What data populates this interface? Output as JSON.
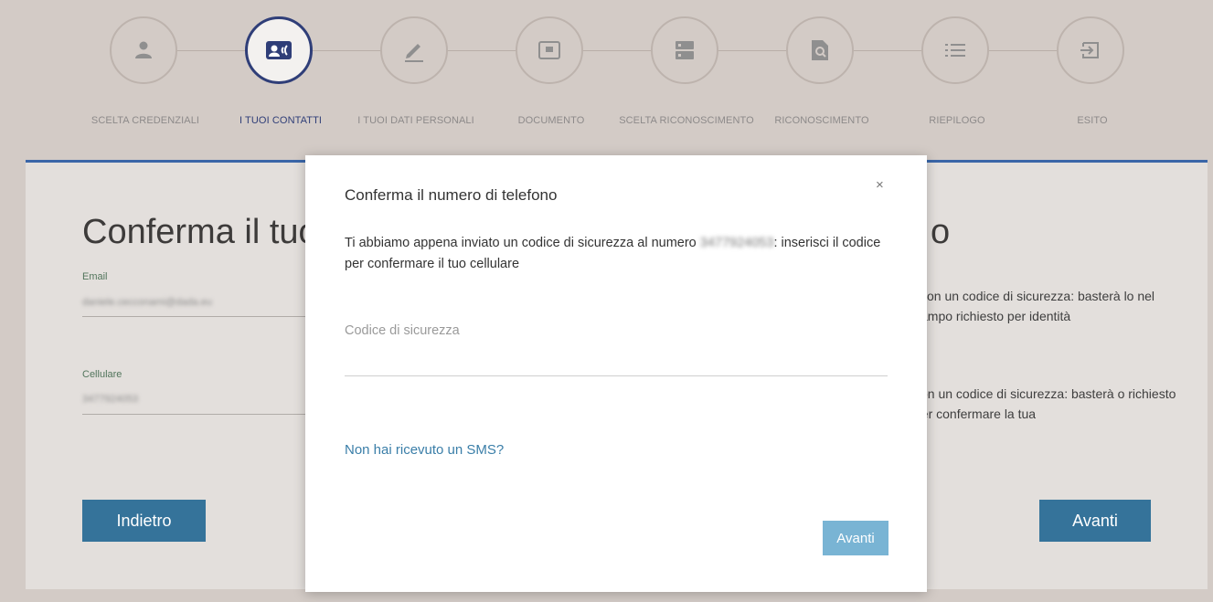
{
  "stepper": {
    "steps": [
      {
        "label": "SCELTA CREDENZIALI",
        "icon": "user-icon"
      },
      {
        "label": "I TUOI CONTATTI",
        "icon": "contact-card-icon"
      },
      {
        "label": "I TUOI DATI PERSONALI",
        "icon": "pencil-icon"
      },
      {
        "label": "DOCUMENTO",
        "icon": "document-icon"
      },
      {
        "label": "SCELTA RICONOSCIMENTO",
        "icon": "server-icon"
      },
      {
        "label": "RICONOSCIMENTO",
        "icon": "search-document-icon"
      },
      {
        "label": "RIEPILOGO",
        "icon": "list-icon"
      },
      {
        "label": "ESITO",
        "icon": "sign-in-icon"
      }
    ],
    "active_index": 1
  },
  "page": {
    "title": "Conferma il tuo",
    "title_right": "o",
    "email": {
      "label": "Email",
      "value": "daniele.cecconami@dada.eu"
    },
    "cellulare": {
      "label": "Cellulare",
      "value": "3477924053"
    },
    "side_text_1": "l con un codice di sicurezza: basterà lo nel campo richiesto per identità",
    "side_text_2": "con un codice di sicurezza: basterà o richiesto per confermare la tua",
    "back_button": "Indietro",
    "next_button": "Avanti"
  },
  "modal": {
    "title": "Conferma il numero di telefono",
    "close": "×",
    "text_before": "Ti abbiamo appena inviato un codice di sicurezza al numero",
    "phone": "3477924053",
    "text_after": ": inserisci il codice per confermare il tuo cellulare",
    "input_placeholder": "Codice di sicurezza",
    "resend_link": "Non hai ricevuto un SMS?",
    "submit_button": "Avanti"
  },
  "colors": {
    "accent": "#2f3e78",
    "button": "#35739a",
    "modal_button": "#79b4d4",
    "link": "#3a7ea8",
    "top_border": "#3a66a8"
  }
}
